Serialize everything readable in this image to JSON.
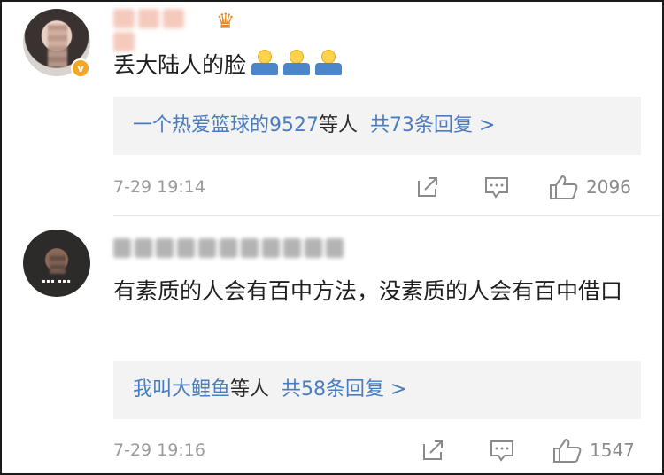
{
  "comments": [
    {
      "text": "丢大陆人的脸",
      "emoji_icon": "shrug-emoji",
      "emoji_count": 3,
      "replies": {
        "names": "一个热爱篮球的9527",
        "suffix": "等人",
        "count_label": "共73条回复 >"
      },
      "time": "7-29 19:14",
      "likes": "2096"
    },
    {
      "text": "有素质的人会有百中方法，没素质的人会有百中借口",
      "replies": {
        "names": "我叫大鲤鱼",
        "suffix": "等人",
        "count_label": "共58条回复 >"
      },
      "time": "7-29 19:16",
      "likes": "1547"
    }
  ],
  "colors": {
    "link": "#4a7dbf",
    "meta": "#9b9b9b",
    "reply_bg": "#f3f3f3",
    "badge": "#f5a623"
  }
}
